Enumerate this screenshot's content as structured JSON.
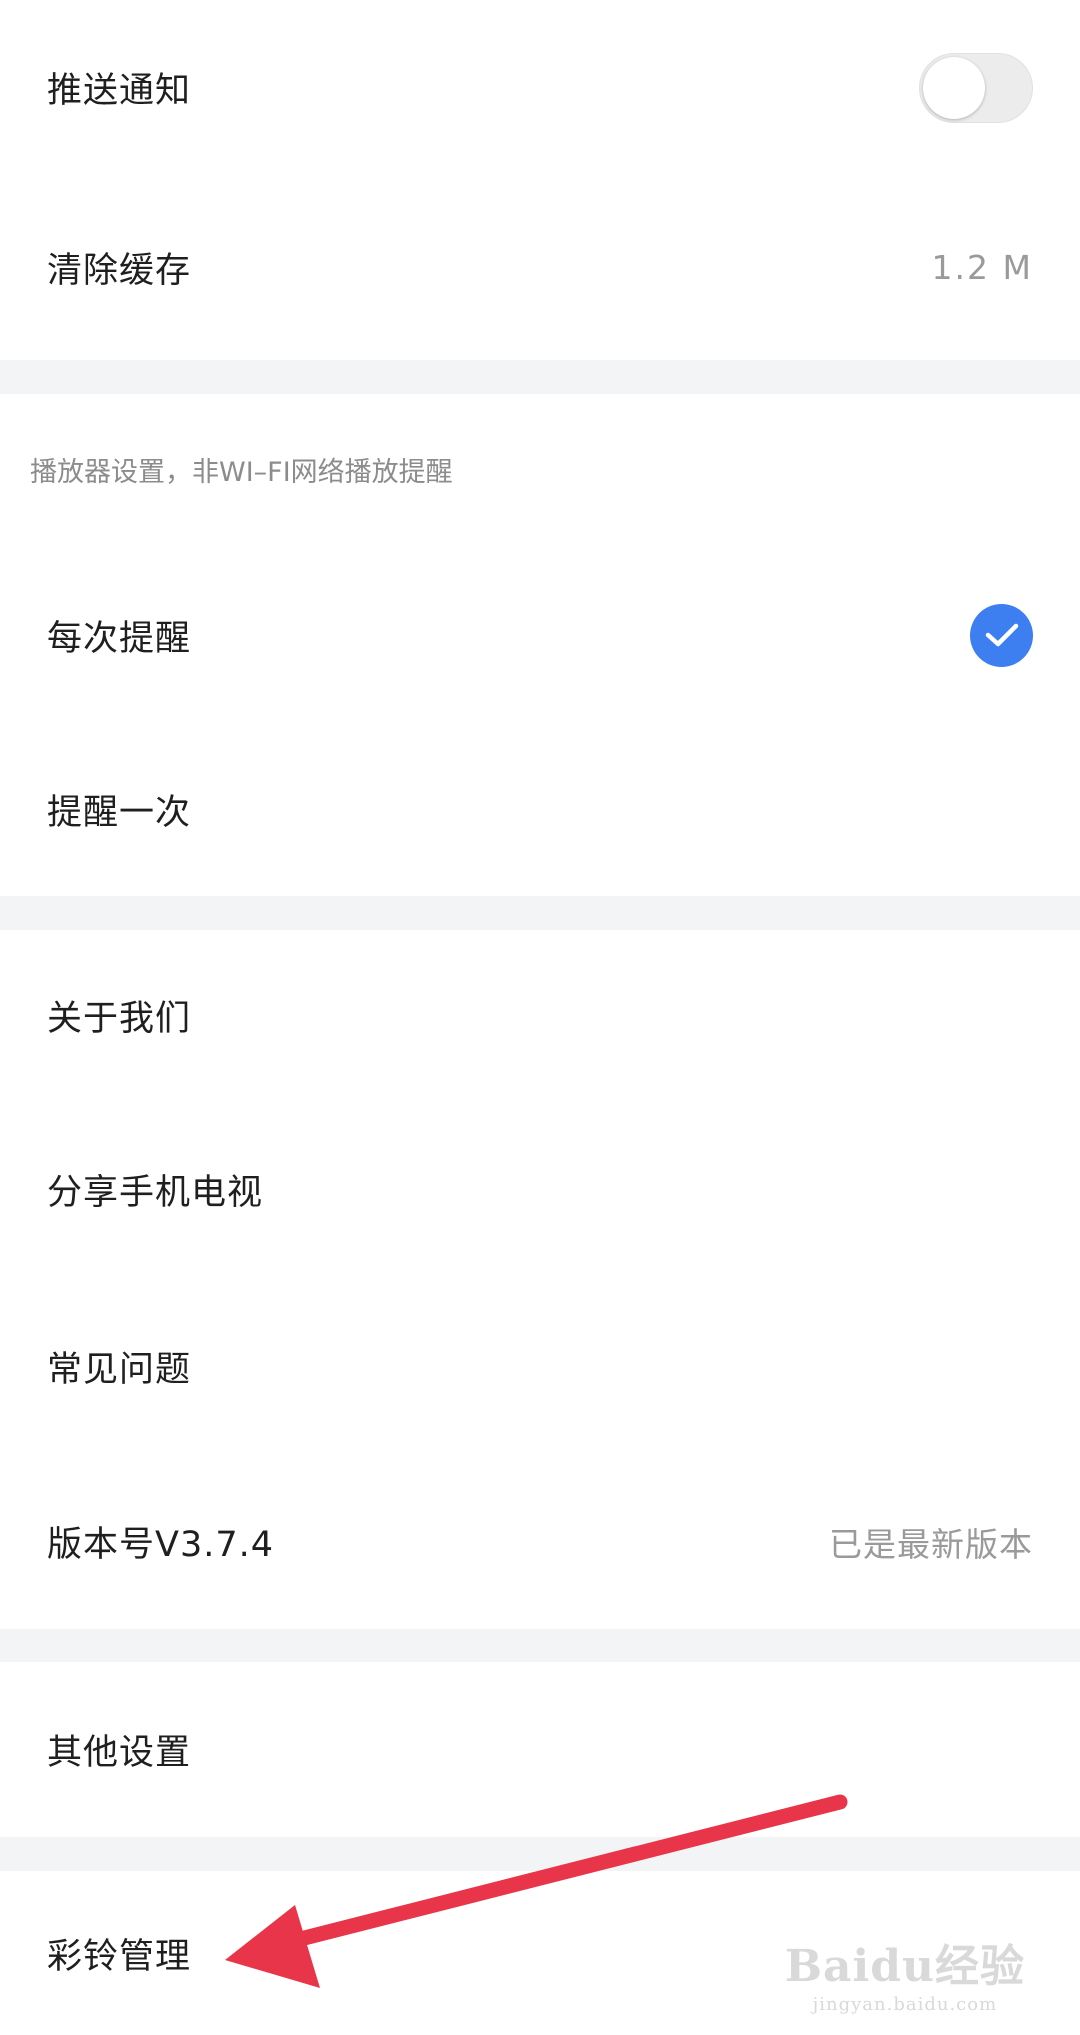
{
  "settings": {
    "push_notification": {
      "label": "推送通知",
      "enabled": false
    },
    "clear_cache": {
      "label": "清除缓存",
      "value": "1.2 M"
    },
    "player_section": {
      "header": "播放器设置，非WI–FI网络播放提醒",
      "options": [
        {
          "label": "每次提醒",
          "selected": true
        },
        {
          "label": "提醒一次",
          "selected": false
        }
      ]
    },
    "about_us": {
      "label": "关于我们"
    },
    "share": {
      "label": "分享手机电视"
    },
    "faq": {
      "label": "常见问题"
    },
    "version": {
      "label": "版本号V3.7.4",
      "status": "已是最新版本"
    },
    "other_settings": {
      "label": "其他设置"
    },
    "ringtone": {
      "label": "彩铃管理"
    }
  },
  "watermark": {
    "main": "Baidu经验",
    "sub": "jingyan.baidu.com"
  },
  "colors": {
    "accent": "#3d7ff0",
    "arrow": "#e8354a",
    "divider": "#f3f4f6",
    "secondary_text": "#9a9a9a"
  }
}
